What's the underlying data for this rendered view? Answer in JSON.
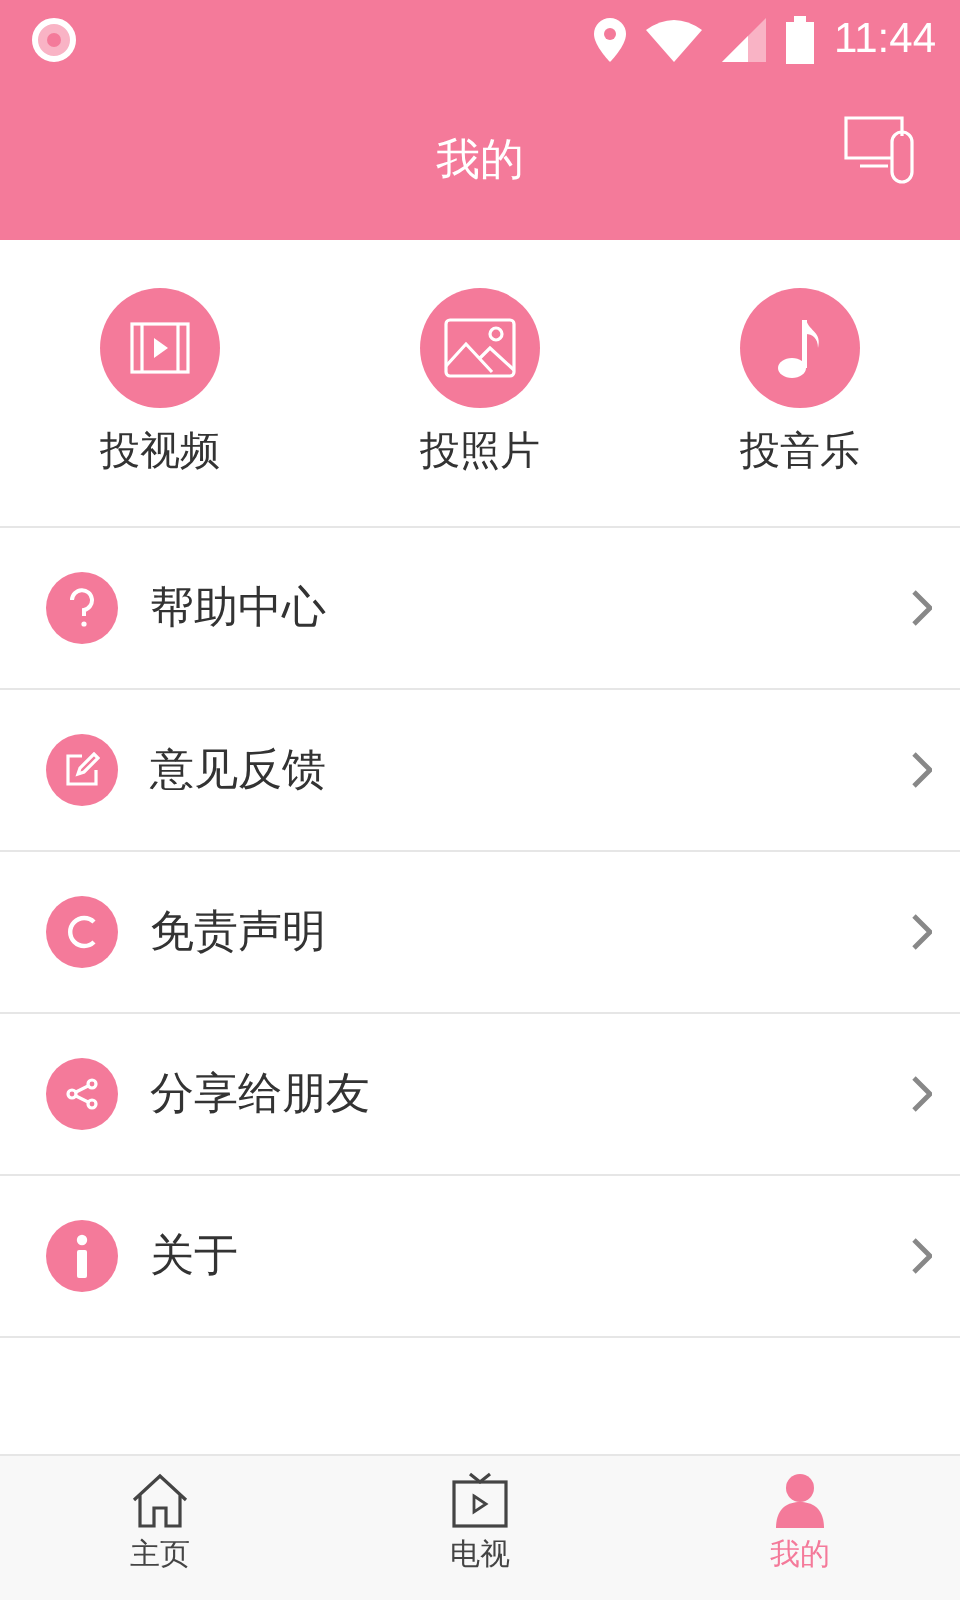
{
  "status_bar": {
    "time": "11:44"
  },
  "header": {
    "title": "我的"
  },
  "actions": [
    {
      "label": "投视频"
    },
    {
      "label": "投照片"
    },
    {
      "label": "投音乐"
    }
  ],
  "menu": [
    {
      "label": "帮助中心"
    },
    {
      "label": "意见反馈"
    },
    {
      "label": "免责声明"
    },
    {
      "label": "分享给朋友"
    },
    {
      "label": "关于"
    }
  ],
  "bottom_nav": [
    {
      "label": "主页",
      "selected": false
    },
    {
      "label": "电视",
      "selected": false
    },
    {
      "label": "我的",
      "selected": true
    }
  ]
}
